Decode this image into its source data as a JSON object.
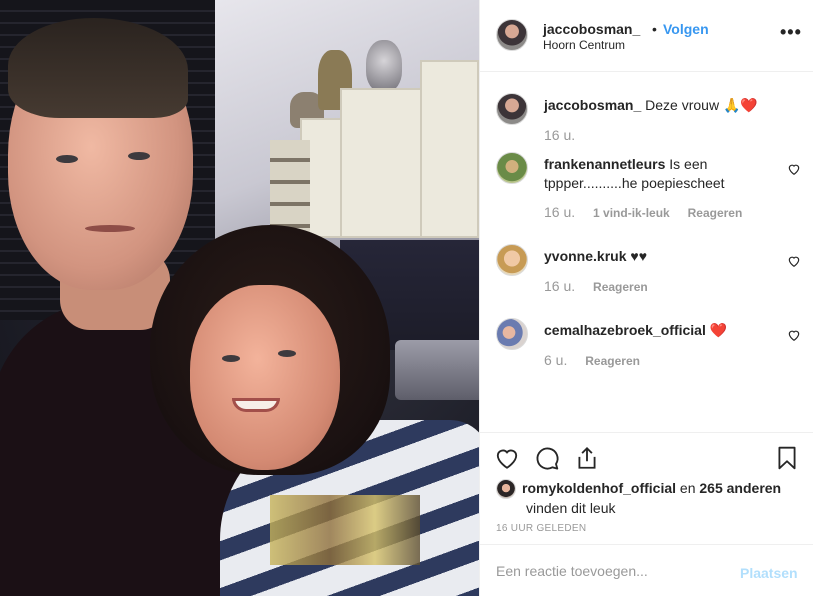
{
  "post": {
    "author": "jaccobosman_",
    "follow_label": "Volgen",
    "separator": "•",
    "location": "Hoorn Centrum",
    "more": "•••"
  },
  "comments": [
    {
      "user": "jaccobosman_",
      "text": "Deze vrouw 🙏❤️",
      "age": "16 u.",
      "likes": "",
      "reply": ""
    },
    {
      "user": "frankenannetleurs",
      "text": "Is een tppper..........he poepiescheet",
      "age": "16 u.",
      "likes": "1 vind-ik-leuk",
      "reply": "Reageren"
    },
    {
      "user": "yvonne.kruk",
      "text": "♥♥",
      "age": "16 u.",
      "likes": "",
      "reply": "Reageren"
    },
    {
      "user": "cemalhazebroek_official",
      "text": "❤️",
      "age": "6 u.",
      "likes": "",
      "reply": "Reageren"
    }
  ],
  "likes": {
    "user": "romykoldenhof_official",
    "connector": " en ",
    "others": "265 anderen",
    "suffix": "vinden dit leuk"
  },
  "timestamp": "16 UUR GELEDEN",
  "add_comment": {
    "placeholder": "Een reactie toevoegen...",
    "post_label": "Plaatsen"
  },
  "colors": {
    "link": "#3897f0",
    "post_disabled": "#b2dffc",
    "muted": "#999999"
  },
  "icons": [
    "heart-icon",
    "comment-icon",
    "share-icon",
    "bookmark-icon",
    "more-icon"
  ]
}
